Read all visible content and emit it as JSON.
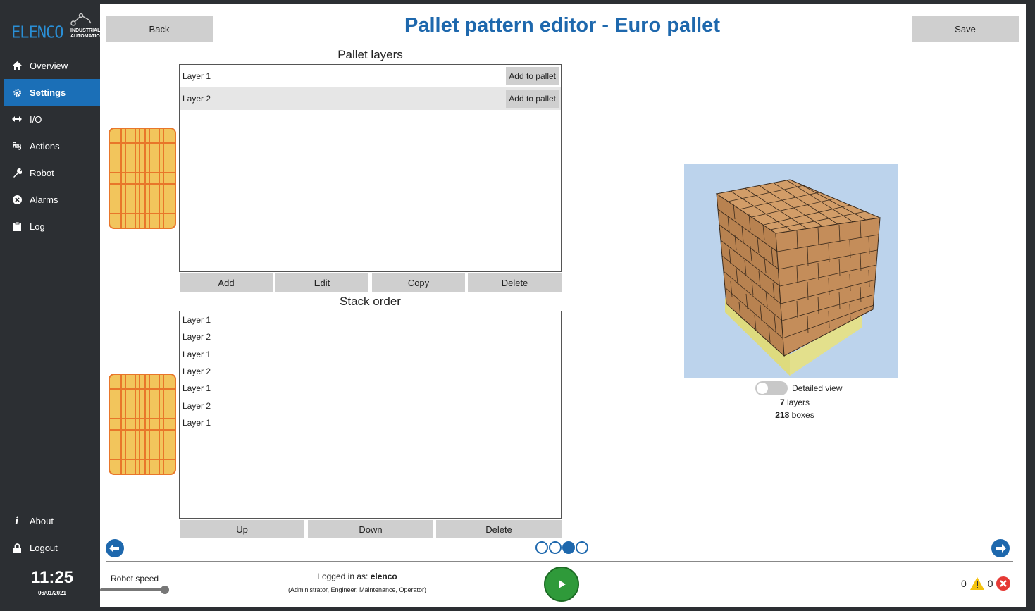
{
  "sidebar": {
    "logo": {
      "brand": "ELENCO",
      "sub_line1": "INDUSTRIAL",
      "sub_line2": "AUTOMATION"
    },
    "items": [
      {
        "label": "Overview",
        "icon": "home-icon"
      },
      {
        "label": "Settings",
        "icon": "gear-icon",
        "active": true
      },
      {
        "label": "I/O",
        "icon": "arrows-icon"
      },
      {
        "label": "Actions",
        "icon": "command-icon"
      },
      {
        "label": "Robot",
        "icon": "wrench-icon"
      },
      {
        "label": "Alarms",
        "icon": "error-circle-icon"
      },
      {
        "label": "Log",
        "icon": "clipboard-icon"
      }
    ],
    "bottom_items": [
      {
        "label": "About",
        "icon": "info-icon"
      },
      {
        "label": "Logout",
        "icon": "lock-icon"
      }
    ],
    "clock": {
      "time": "11:25",
      "date": "06/01/2021"
    }
  },
  "header": {
    "back_label": "Back",
    "title": "Pallet pattern editor - Euro pallet",
    "save_label": "Save"
  },
  "pallet_layers": {
    "title": "Pallet layers",
    "rows": [
      {
        "label": "Layer 1",
        "action": "Add to pallet"
      },
      {
        "label": "Layer 2",
        "action": "Add to pallet"
      }
    ],
    "buttons": {
      "add": "Add",
      "edit": "Edit",
      "copy": "Copy",
      "delete": "Delete"
    }
  },
  "stack_order": {
    "title": "Stack order",
    "rows": [
      "Layer 1",
      "Layer 2",
      "Layer 1",
      "Layer 2",
      "Layer 1",
      "Layer 2",
      "Layer 1"
    ],
    "buttons": {
      "up": "Up",
      "down": "Down",
      "delete": "Delete"
    }
  },
  "preview": {
    "detailed_view_label": "Detailed view",
    "detailed_view_on": false,
    "layers_count": "7",
    "layers_label": "layers",
    "boxes_count": "218",
    "boxes_label": "boxes"
  },
  "pagination": {
    "pages": 4,
    "current": 3
  },
  "footer": {
    "robot_speed_label": "Robot speed",
    "robot_speed_value": 0.95,
    "logged_in_prefix": "Logged in as:",
    "user": "elenco",
    "roles": "(Administrator, Engineer, Maintenance, Operator)",
    "warnings_count": "0",
    "errors_count": "0"
  },
  "colors": {
    "accent": "#1e68ad",
    "active_nav": "#1b6fb7",
    "play": "#2f9a3a",
    "pallet_fill": "#f2c55c",
    "pallet_stroke": "#e8762a",
    "box": "#c8925d",
    "preview_bg": "#bcd3ec"
  }
}
